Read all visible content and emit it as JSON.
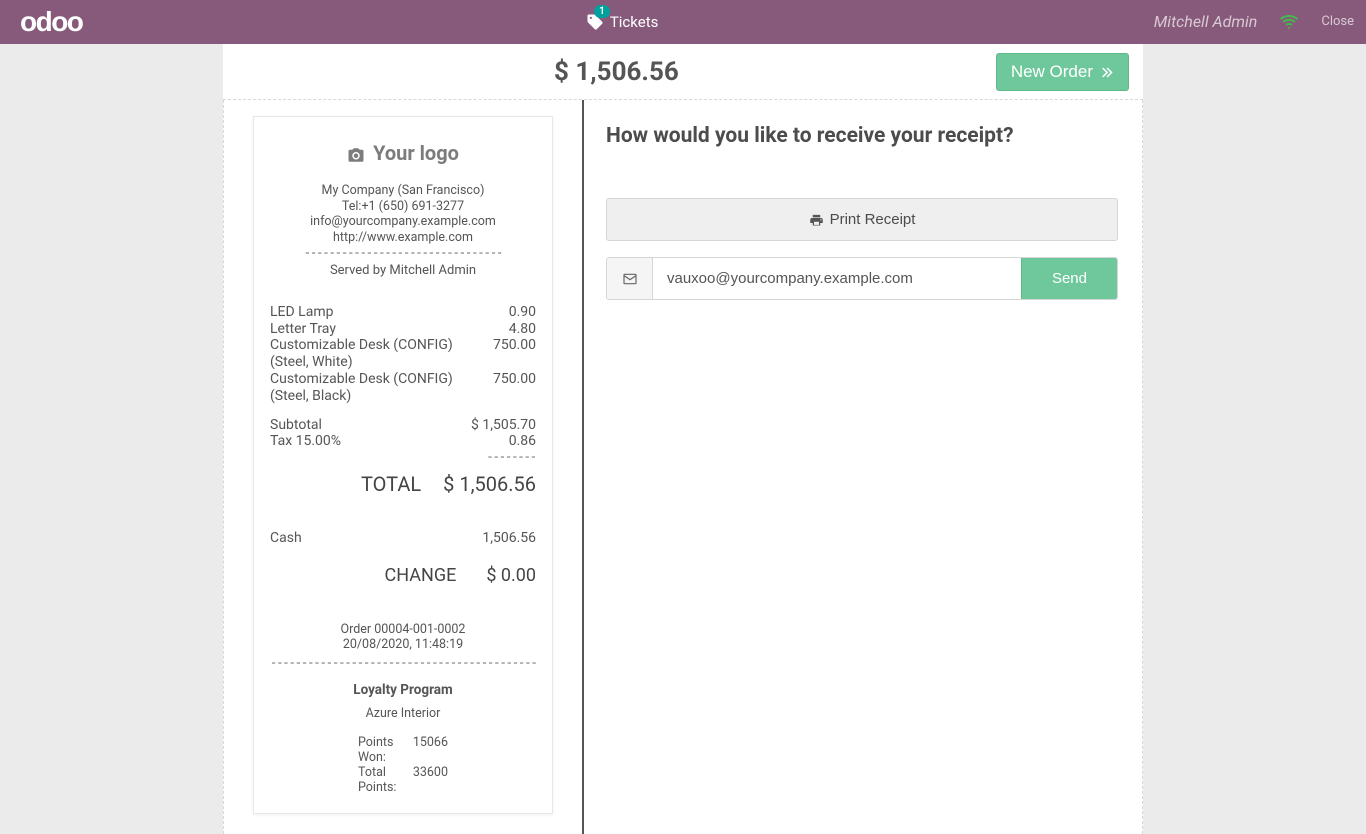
{
  "navbar": {
    "logo_text": "odoo",
    "tickets_label": "Tickets",
    "tickets_badge": "1",
    "user_name": "Mitchell Admin",
    "close_label": "Close"
  },
  "topbar": {
    "total_display": "$ 1,506.56",
    "new_order_label": "New Order"
  },
  "receipt": {
    "logo_text": "Your logo",
    "company": "My Company (San Francisco)",
    "tel": "Tel:+1 (650) 691-3277",
    "email": "info@yourcompany.example.com",
    "website": "http://www.example.com",
    "served_by": "Served by Mitchell Admin",
    "items": [
      {
        "name": "LED Lamp",
        "amount": "0.90"
      },
      {
        "name": "Letter Tray",
        "amount": "4.80"
      },
      {
        "name": "Customizable Desk (CONFIG) (Steel, White)",
        "amount": "750.00"
      },
      {
        "name": "Customizable Desk (CONFIG) (Steel, Black)",
        "amount": "750.00"
      }
    ],
    "subtotal_label": "Subtotal",
    "subtotal_amount": "$ 1,505.70",
    "tax_label": "Tax 15.00%",
    "tax_amount": "0.86",
    "total_label": "TOTAL",
    "total_amount": "$ 1,506.56",
    "payment_method": "Cash",
    "payment_amount": "1,506.56",
    "change_label": "CHANGE",
    "change_amount": "$ 0.00",
    "order_number": "Order 00004-001-0002",
    "order_datetime": "20/08/2020, 11:48:19",
    "loyalty_title": "Loyalty Program",
    "loyalty_customer": "Azure Interior",
    "loyalty_points_won_label": "Points Won:",
    "loyalty_points_won_value": "15066",
    "loyalty_total_points_label": "Total Points:",
    "loyalty_total_points_value": "33600"
  },
  "right": {
    "question": "How would you like to receive your receipt?",
    "print_label": "Print Receipt",
    "email_value": "vauxoo@yourcompany.example.com",
    "send_label": "Send"
  }
}
